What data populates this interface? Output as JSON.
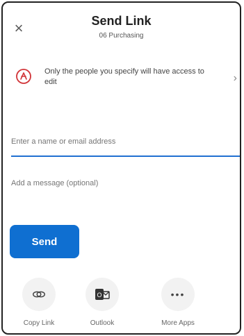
{
  "header": {
    "title": "Send Link",
    "subtitle": "06 Purchasing"
  },
  "permission": {
    "text": "Only the people you specify will have access to edit"
  },
  "recipient": {
    "placeholder": "Enter a name or email address"
  },
  "message": {
    "placeholder": "Add a message (optional)"
  },
  "actions": {
    "send_label": "Send"
  },
  "apps": [
    {
      "label": "Copy Link",
      "icon": "link-icon"
    },
    {
      "label": "Outlook",
      "icon": "outlook-icon"
    },
    {
      "label": "More Apps",
      "icon": "more-icon"
    }
  ],
  "colors": {
    "accent": "#0f6fd1",
    "warning": "#d13438"
  }
}
